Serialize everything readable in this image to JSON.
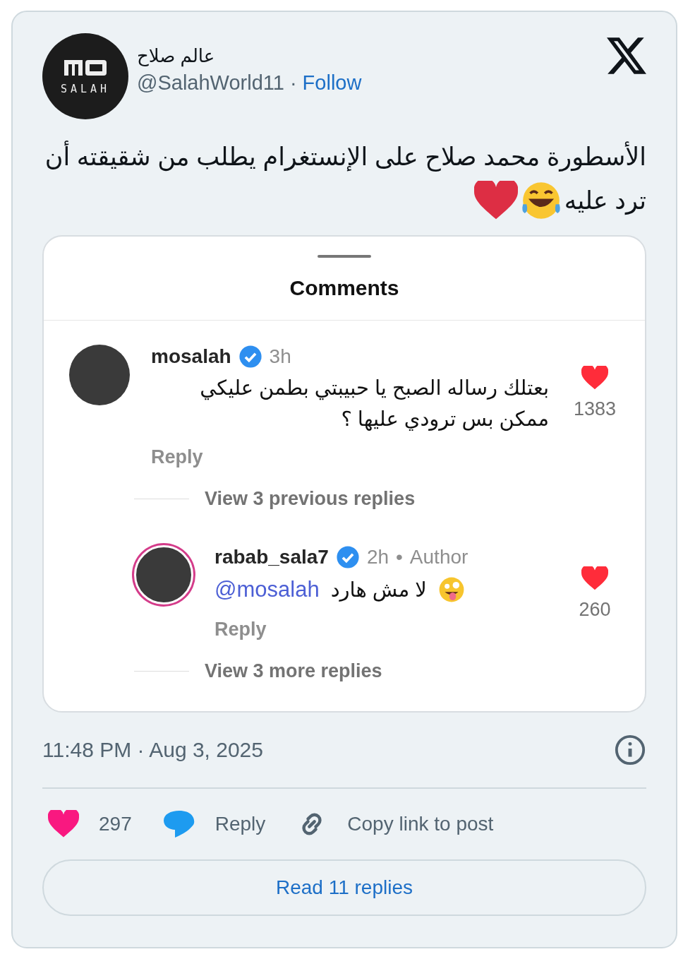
{
  "author": {
    "name": "عالم صلاح",
    "handle": "@SalahWorld11",
    "separator": "·",
    "follow": "Follow",
    "logo_text": "SALAH"
  },
  "tweet_text": [
    "الأسطورة محمد صلاح على الإنستغرام يطلب من شقيقته أن",
    "ترد عليه"
  ],
  "embedded_screenshot": {
    "title": "Comments",
    "comments": [
      {
        "user": "mosalah",
        "verified": true,
        "time": "3h",
        "lines": [
          "بعتلك رساله الصبح يا حبيبتي بطمن عليكي",
          "ممكن بس ترودي عليها ؟"
        ],
        "likes": "1383",
        "reply": "Reply",
        "view_more": "View 3 previous replies",
        "children": [
          {
            "user": "rabab_sala7",
            "verified": true,
            "time": "2h",
            "dot": "•",
            "badge": "Author",
            "mention": "@mosalah",
            "text": "لا مش هارد",
            "likes": "260",
            "reply": "Reply",
            "view_more": "View 3 more replies"
          }
        ]
      }
    ]
  },
  "timestamp": "11:48 PM · Aug 3, 2025",
  "actions": [
    {
      "kind": "like",
      "label": "297"
    },
    {
      "kind": "reply",
      "label": "Reply"
    },
    {
      "kind": "link",
      "label": "Copy link to post"
    }
  ],
  "read_replies": "Read 11 replies"
}
